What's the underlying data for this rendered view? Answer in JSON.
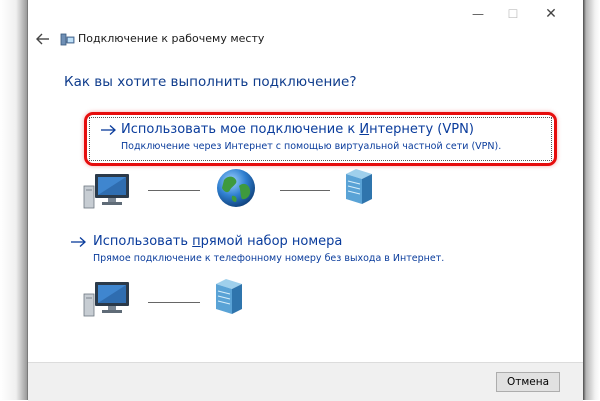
{
  "window": {
    "title": "Подключение к рабочему месту",
    "caption_buttons": {
      "minimize": "—",
      "maximize": "☐",
      "close": "✕"
    }
  },
  "header": {
    "back_icon": "back-arrow-icon",
    "app_icon": "network-icon"
  },
  "question": "Как вы хотите выполнить подключение?",
  "options": [
    {
      "title_pre": "Использовать мое подключение к ",
      "title_access_key": "И",
      "title_post": "нтернету (VPN)",
      "description": "Подключение через Интернет с помощью виртуальной частной сети (VPN).",
      "highlighted": true,
      "diagram": [
        "computer-icon",
        "globe-icon",
        "server-icon"
      ]
    },
    {
      "title_pre": "Использовать ",
      "title_access_key": "п",
      "title_post": "рямой набор номера",
      "description": "Прямое подключение к телефонному номеру без выхода в Интернет.",
      "highlighted": false,
      "diagram": [
        "computer-icon",
        "server-icon"
      ]
    }
  ],
  "footer": {
    "cancel_label": "Отмена"
  },
  "colors": {
    "link": "#0a3c9c",
    "highlight": "#e60d0d",
    "footer_bg": "#f0f0f0"
  }
}
